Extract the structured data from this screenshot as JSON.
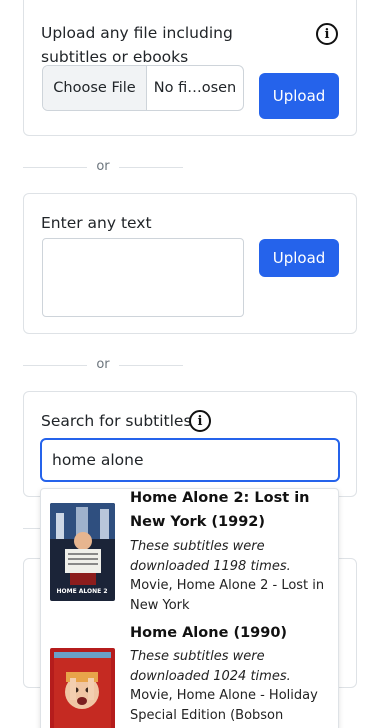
{
  "upload_file_card": {
    "label": "Upload any file including subtitles or ebooks",
    "info_glyph": "i",
    "choose_file_label": "Choose File",
    "file_name": "No fi…osen",
    "upload_label": "Upload"
  },
  "divider_1": {
    "label": "or"
  },
  "text_card": {
    "label": "Enter any text",
    "textarea_value": "",
    "upload_label": "Upload"
  },
  "divider_2": {
    "label": "or"
  },
  "search_card": {
    "label": "Search for subtitles",
    "info_glyph": "i",
    "query": "home alone"
  },
  "results": [
    {
      "title": "Home Alone 2: Lost in New York (1992)",
      "count_text": "These subtitles were downloaded 1198 times.",
      "description": "Movie, Home Alone 2 - Lost in New York",
      "poster_text": "HOME ALONE 2"
    },
    {
      "title": "Home Alone (1990)",
      "count_text": "These subtitles were downloaded 1024 times.",
      "description": "Movie, Home Alone - Holiday Special Edition (Bobson",
      "poster_text": ""
    }
  ],
  "colors": {
    "accent": "#2563eb",
    "border": "#dee2e6"
  },
  "icons": [
    "info-icon",
    "info-icon"
  ]
}
